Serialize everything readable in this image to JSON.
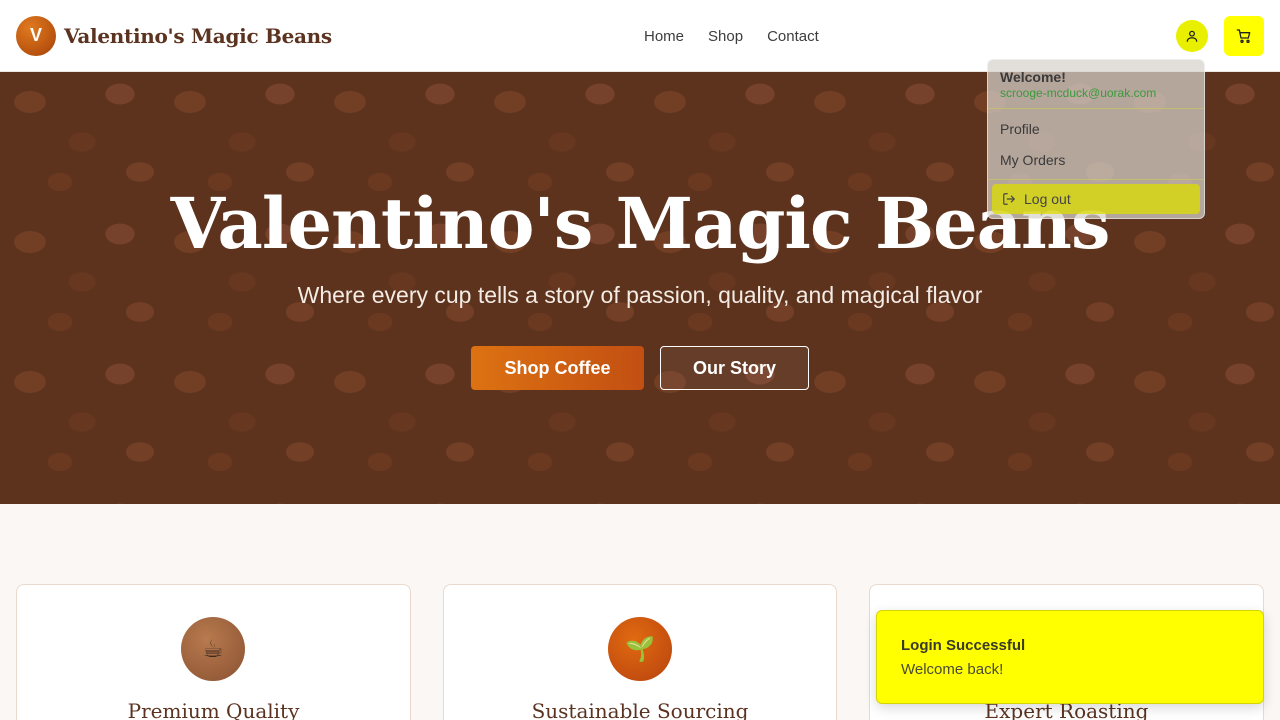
{
  "header": {
    "logo_letter": "V",
    "brand": "Valentino's Magic Beans",
    "nav": [
      "Home",
      "Shop",
      "Contact"
    ]
  },
  "hero": {
    "title": "Valentino's Magic Beans",
    "subtitle": "Where every cup tells a story of passion, quality, and magical flavor",
    "primary_cta": "Shop Coffee",
    "secondary_cta": "Our Story"
  },
  "user_menu": {
    "welcome": "Welcome!",
    "email": "scrooge-mcduck@uorak.com",
    "items": [
      "Profile",
      "My Orders"
    ],
    "logout": "Log out"
  },
  "features": [
    {
      "icon": "☕",
      "title": "Premium Quality"
    },
    {
      "icon": "🌱",
      "title": "Sustainable Sourcing"
    },
    {
      "icon": "",
      "title": "Expert Roasting"
    }
  ],
  "toast": {
    "title": "Login Successful",
    "message": "Welcome back!"
  },
  "colors": {
    "accent_yellow": "#ffff00",
    "brand_brown": "#5b3320",
    "cta_orange": "#dd7212"
  }
}
